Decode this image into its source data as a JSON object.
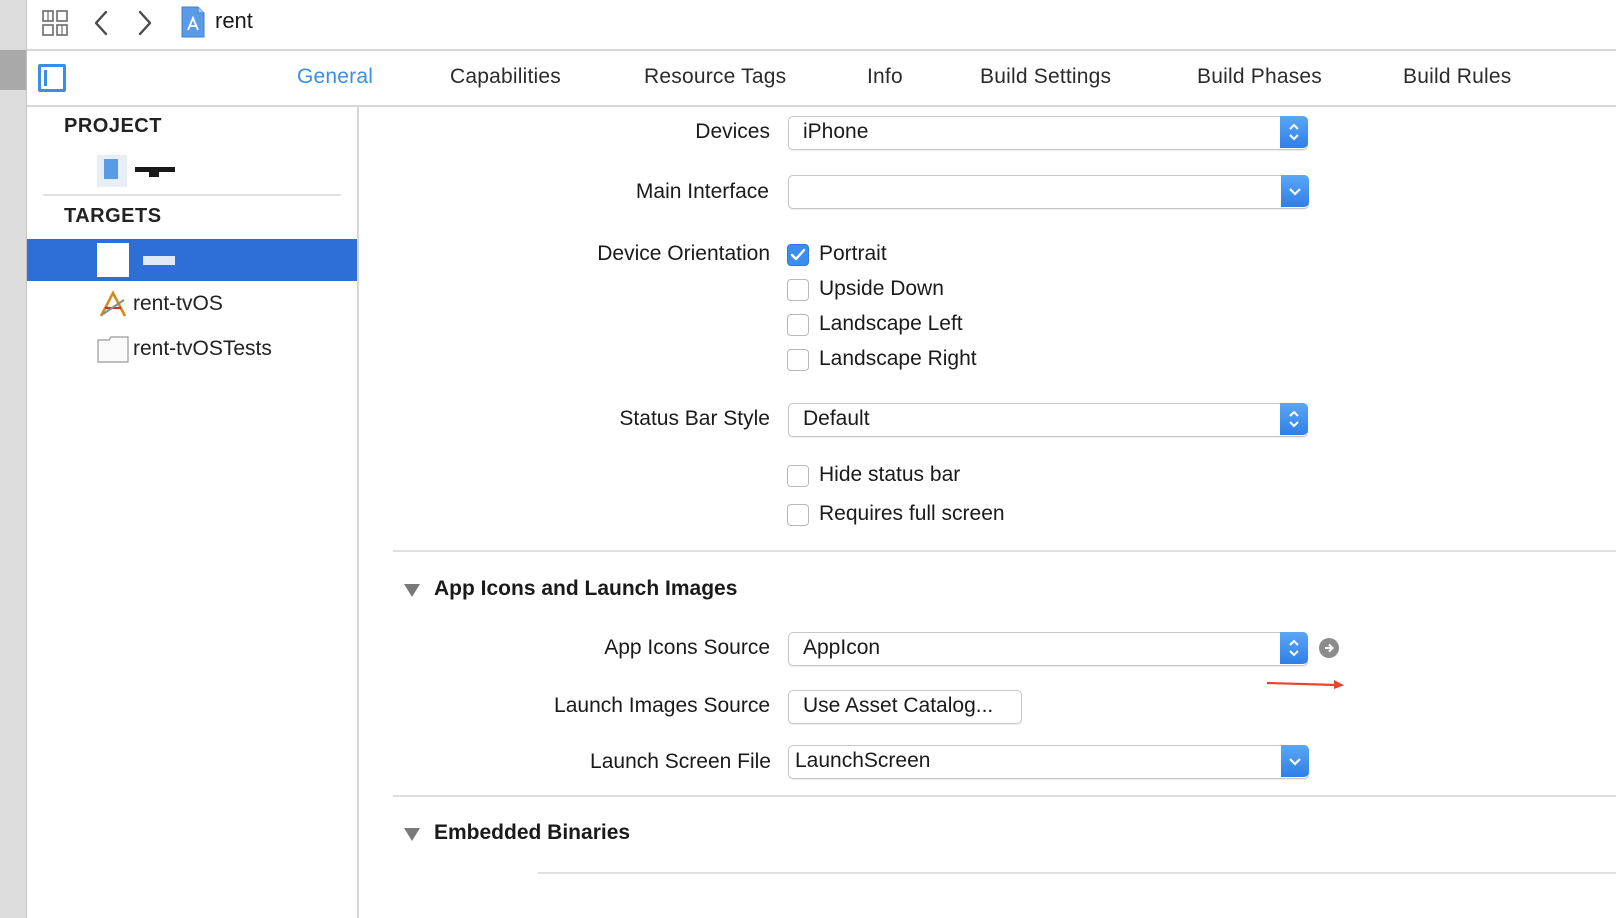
{
  "toolbar": {
    "file_title": "rent"
  },
  "tabs": [
    {
      "label": "General",
      "active": true
    },
    {
      "label": "Capabilities",
      "active": false
    },
    {
      "label": "Resource Tags",
      "active": false
    },
    {
      "label": "Info",
      "active": false
    },
    {
      "label": "Build Settings",
      "active": false
    },
    {
      "label": "Build Phases",
      "active": false
    },
    {
      "label": "Build Rules",
      "active": false
    }
  ],
  "sidebar": {
    "project_header": "PROJECT",
    "targets_header": "TARGETS",
    "targets": [
      {
        "label": "rent-tvOS",
        "icon": "tvos-app-icon"
      },
      {
        "label": "rent-tvOSTests",
        "icon": "test-bundle-icon"
      }
    ]
  },
  "deployment": {
    "devices_label": "Devices",
    "devices_value": "iPhone",
    "main_interface_label": "Main Interface",
    "main_interface_value": "",
    "device_orientation_label": "Device Orientation",
    "orientations": [
      {
        "label": "Portrait",
        "checked": true
      },
      {
        "label": "Upside Down",
        "checked": false
      },
      {
        "label": "Landscape Left",
        "checked": false
      },
      {
        "label": "Landscape Right",
        "checked": false
      }
    ],
    "status_bar_style_label": "Status Bar Style",
    "status_bar_style_value": "Default",
    "hide_status_bar": {
      "label": "Hide status bar",
      "checked": false
    },
    "requires_full_screen": {
      "label": "Requires full screen",
      "checked": false
    }
  },
  "app_icons": {
    "section_title": "App Icons and Launch Images",
    "app_icons_source_label": "App Icons Source",
    "app_icons_source_value": "AppIcon",
    "launch_images_source_label": "Launch Images Source",
    "launch_images_button": "Use Asset Catalog...",
    "launch_screen_file_label": "Launch Screen File",
    "launch_screen_file_value": "LaunchScreen"
  },
  "embedded": {
    "section_title": "Embedded Binaries"
  },
  "colors": {
    "accent": "#3a8ee6",
    "selection": "#2d6fd6",
    "annotation_arrow": "#e8452c"
  }
}
